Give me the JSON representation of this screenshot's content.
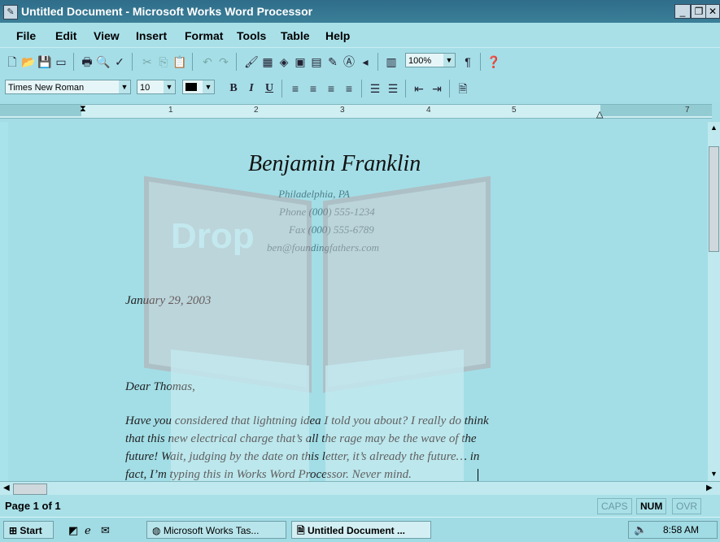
{
  "window": {
    "title": "Untitled Document - Microsoft Works Word Processor"
  },
  "menus": [
    "File",
    "Edit",
    "View",
    "Insert",
    "Format",
    "Tools",
    "Table",
    "Help"
  ],
  "format_bar": {
    "font_name": "Times New Roman",
    "font_size": "10",
    "zoom": "100%"
  },
  "ruler": {
    "numbers": [
      "1",
      "2",
      "3",
      "4",
      "5",
      "7"
    ]
  },
  "letter": {
    "sender_name": "Benjamin Franklin",
    "address_lines": [
      "Philadelphia, PA",
      "Phone (000) 555-1234",
      "Fax (000) 555-6789",
      "ben@foundingfathers.com"
    ],
    "date": "January 29, 2003",
    "salutation": "Dear Thomas,",
    "body_lines": [
      "Have you considered that lightning idea I told you about?  I really do think",
      "that this new electrical charge that’s all the rage may be the wave of the",
      "future!  Wait, judging by the date on this letter, it’s already the future…  in",
      "fact, I’m typing this in Works Word Processor.  Never mind."
    ]
  },
  "statusbar": {
    "page": "Page 1 of 1",
    "caps": "CAPS",
    "num": "NUM",
    "ovr": "OVR"
  },
  "taskbar": {
    "start": "Start",
    "tasks": [
      "Microsoft Works Tas...",
      "Untitled Document ..."
    ],
    "clock": "8:58 AM"
  },
  "watermark": {
    "text": "Drop"
  }
}
